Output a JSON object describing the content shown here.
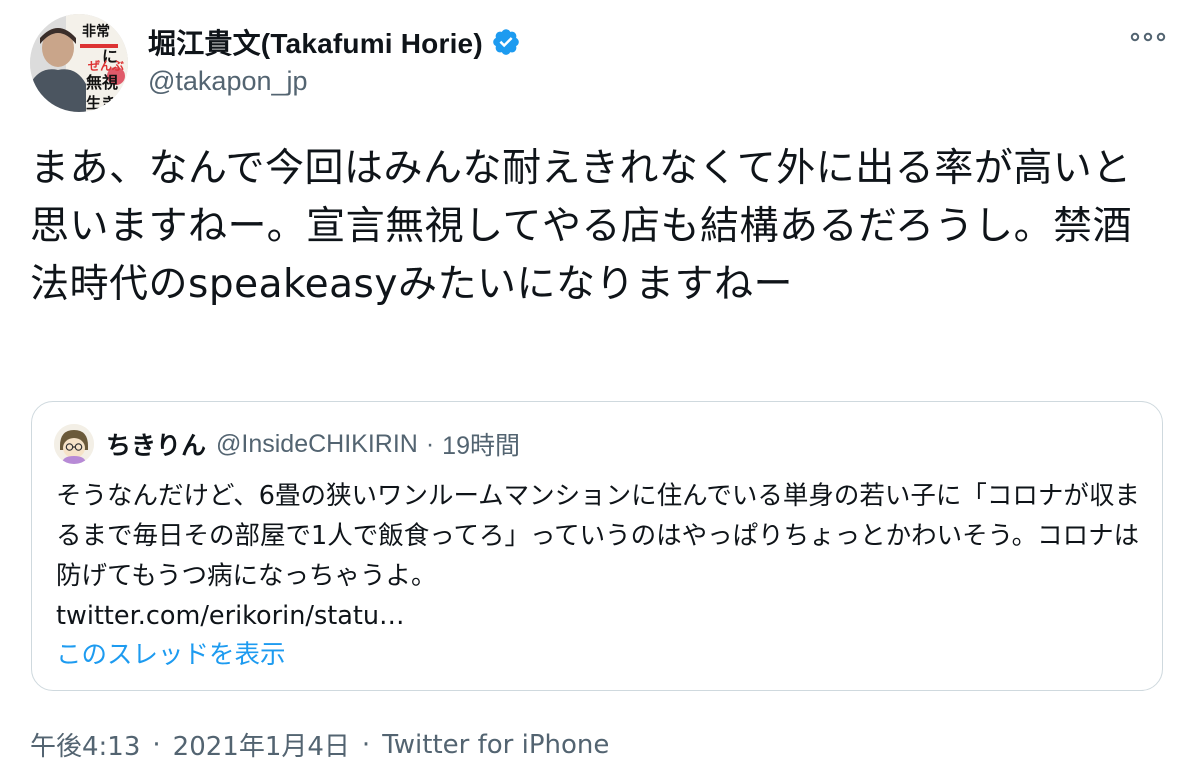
{
  "author": {
    "display_name": "堀江貴文(Takafumi Horie)",
    "handle": "@takapon_jp",
    "verified": true,
    "verified_color": "#1d9bf0",
    "avatar_text": "非常識にぜんぶ無視して生きろ"
  },
  "tweet": {
    "text": "まあ、なんで今回はみんな耐えきれなくて外に出る率が高いと思いますねー。宣言無視してやる店も結構あるだろうし。禁酒法時代のspeakeasyみたいになりますねー"
  },
  "quoted_tweet": {
    "display_name": "ちきりん",
    "handle": "@InsideCHIKIRIN",
    "separator": "·",
    "time": "19時間",
    "text": "そうなんだけど、6畳の狭いワンルームマンションに住んでいる単身の若い子に「コロナが収まるまで毎日その部屋で1人で飯食ってろ」っていうのはやっぱりちょっとかわいそう。コロナは防げてもうつ病になっちゃうよ。",
    "link": "twitter.com/erikorin/statu…",
    "show_thread": "このスレッドを表示"
  },
  "meta": {
    "time": "午後4:13",
    "separator": "·",
    "date": "2021年1月4日",
    "source": "Twitter for iPhone"
  },
  "colors": {
    "text": "#0f1419",
    "secondary": "#536471",
    "link": "#1d9bf0",
    "border": "#cfd9de"
  },
  "icons": {
    "more": "more-horizontal-icon",
    "verified": "verified-badge-icon"
  }
}
